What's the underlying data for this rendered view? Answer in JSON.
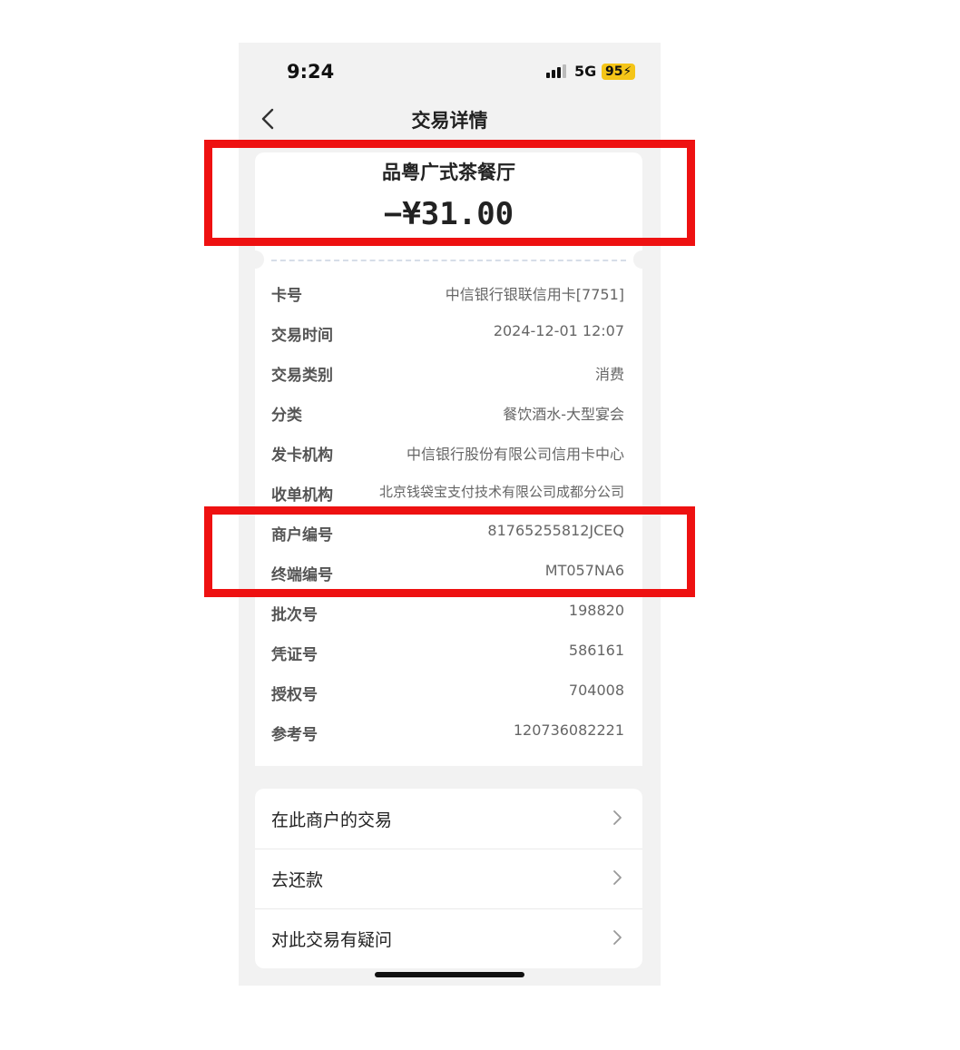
{
  "status_bar": {
    "time": "9:24",
    "network": "5G",
    "battery": "95"
  },
  "nav": {
    "title": "交易详情",
    "back_icon": "chevron-left-icon"
  },
  "transaction": {
    "merchant_name": "品粤广式茶餐厅",
    "amount": "−¥31.00"
  },
  "details": [
    {
      "label": "卡号",
      "value": "中信银行银联信用卡[7751]"
    },
    {
      "label": "交易时间",
      "value": "2024-12-01 12:07"
    },
    {
      "label": "交易类别",
      "value": "消费"
    },
    {
      "label": "分类",
      "value": "餐饮酒水-大型宴会"
    },
    {
      "label": "发卡机构",
      "value": "中信银行股份有限公司信用卡中心"
    },
    {
      "label": "收单机构",
      "value": "北京钱袋宝支付技术有限公司成都分公司"
    },
    {
      "label": "商户编号",
      "value": "81765255812JCEQ"
    },
    {
      "label": "终端编号",
      "value": "MT057NA6"
    },
    {
      "label": "批次号",
      "value": "198820"
    },
    {
      "label": "凭证号",
      "value": "586161"
    },
    {
      "label": "授权号",
      "value": "704008"
    },
    {
      "label": "参考号",
      "value": "120736082221"
    }
  ],
  "menu": [
    {
      "label": "在此商户的交易",
      "icon": "chevron-right-icon"
    },
    {
      "label": "去还款",
      "icon": "chevron-right-icon"
    },
    {
      "label": "对此交易有疑问",
      "icon": "chevron-right-icon"
    }
  ],
  "colors": {
    "highlight": "#ee1111",
    "background": "#f2f2f2",
    "card": "#ffffff",
    "battery": "#f5c518"
  }
}
